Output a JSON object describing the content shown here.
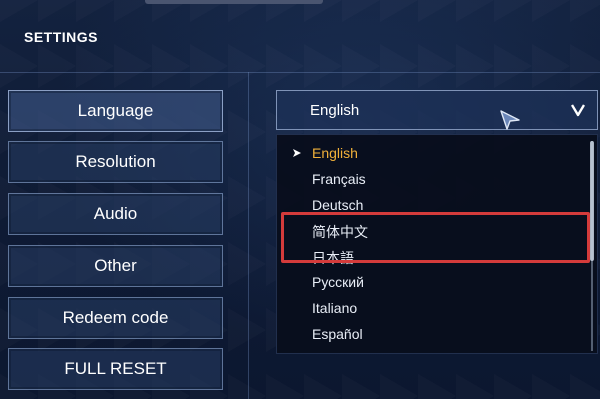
{
  "screen": {
    "title": "SETTINGS"
  },
  "menu": {
    "items": [
      {
        "label": "Language"
      },
      {
        "label": "Resolution"
      },
      {
        "label": "Audio"
      },
      {
        "label": "Other"
      },
      {
        "label": "Redeem code"
      },
      {
        "label": "FULL RESET"
      }
    ],
    "active_item": "Language"
  },
  "language_select": {
    "current_value": "English",
    "options": [
      {
        "label": "English"
      },
      {
        "label": "Français"
      },
      {
        "label": "Deutsch"
      },
      {
        "label": "简体中文"
      },
      {
        "label": "日本語"
      },
      {
        "label": "Русский"
      },
      {
        "label": "Italiano"
      },
      {
        "label": "Español"
      }
    ],
    "selected_option": "English"
  },
  "colors": {
    "selected_option": "#f0b03a",
    "highlight_box": "#d43b3b",
    "background": "#0f1c36"
  },
  "icons": {
    "dropdown": "chevron-down-icon",
    "selected_marker": "arrow-right-icon",
    "pointer": "cursor-icon"
  }
}
